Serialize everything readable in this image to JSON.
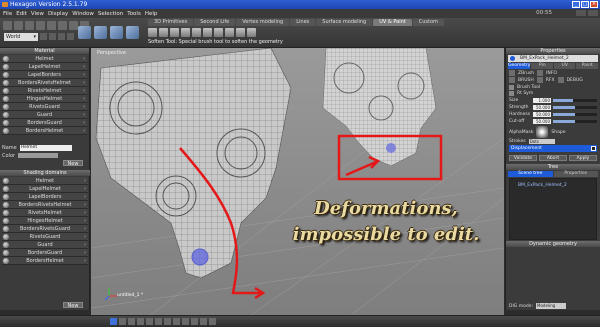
{
  "window": {
    "title": "Hexagon Version 2.5.1.79"
  },
  "menu": [
    "File",
    "Edit",
    "View",
    "Display",
    "Window",
    "Selection",
    "Tools",
    "Help"
  ],
  "clock": "00:55",
  "toolbar": {
    "world_select": "World",
    "tabs": [
      "3D Primitives",
      "Second Life",
      "Vertex modeling",
      "Lines",
      "Surface modeling",
      "UV & Paint",
      "Custom"
    ],
    "active_tab": 5,
    "tooltip": "Soften Tool: Special brush tool to soften the geometry"
  },
  "left_panel": {
    "header": "Material",
    "materials": [
      "Helmet",
      "LapelHelmet",
      "LapelBorders",
      "BordersRivetsHelmet",
      "RivetsHelmet",
      "HingesHelmet",
      "RivetsGuard",
      "Guard",
      "BordersGuard",
      "BordersHelmet"
    ],
    "name_label": "Name",
    "name_value": "Helmet",
    "color_label": "Color",
    "new_label": "New",
    "shading_header": "Shading domains",
    "domains": [
      "Helmet",
      "LapelHelmet",
      "LapelBorders",
      "BordersRivetsHelmet",
      "RivetsHelmet",
      "HingesHelmet",
      "BordersRivetsGuard",
      "RivetsGuard",
      "Guard",
      "BordersGuard",
      "BordersHelmet"
    ],
    "new2_label": "New"
  },
  "viewport": {
    "label": "Perspective",
    "caption_line1": "Deformations,",
    "caption_line2": "impossible to edit.",
    "axis_label": "untitled_1 *"
  },
  "right_panel": {
    "header": "Properties",
    "material_name": "BM_ExPack_Helmet_2",
    "sub_tabs": [
      "Geometry",
      "Pin",
      "UV",
      "Paint"
    ],
    "symmetry_items": [
      "ZBrush",
      "INFO",
      "BRUSH",
      "RFX",
      "DEBUG"
    ],
    "brush_tool_label": "Brush Tool",
    "rt_sym_label": "Rt Sym",
    "sliders": [
      {
        "label": "Size",
        "value": "1.000",
        "fill": 0.45
      },
      {
        "label": "Strength",
        "value": "50.000",
        "fill": 0.5
      },
      {
        "label": "Hardness",
        "value": "50.000",
        "fill": 0.5
      },
      {
        "label": "Cut-off",
        "value": "50.000",
        "fill": 0.5
      }
    ],
    "alpha_label": "AlphaMask",
    "shape_label": "Shape",
    "strokes_label": "Strokes",
    "strokes_value": "Dots",
    "displacement_label": "Displacement",
    "actions": [
      "Validate",
      "Abort",
      "Apply"
    ],
    "tree_header": "Tree",
    "tree_tabs": [
      "Scene tree",
      "Properties"
    ],
    "scene_item": "BM_ExPack_Helmet_2",
    "dynamic_header": "Dynamic geometry",
    "mode_label": "DIG mode:",
    "mode_value": "Modeling",
    "accent": "#1e5bd8"
  }
}
